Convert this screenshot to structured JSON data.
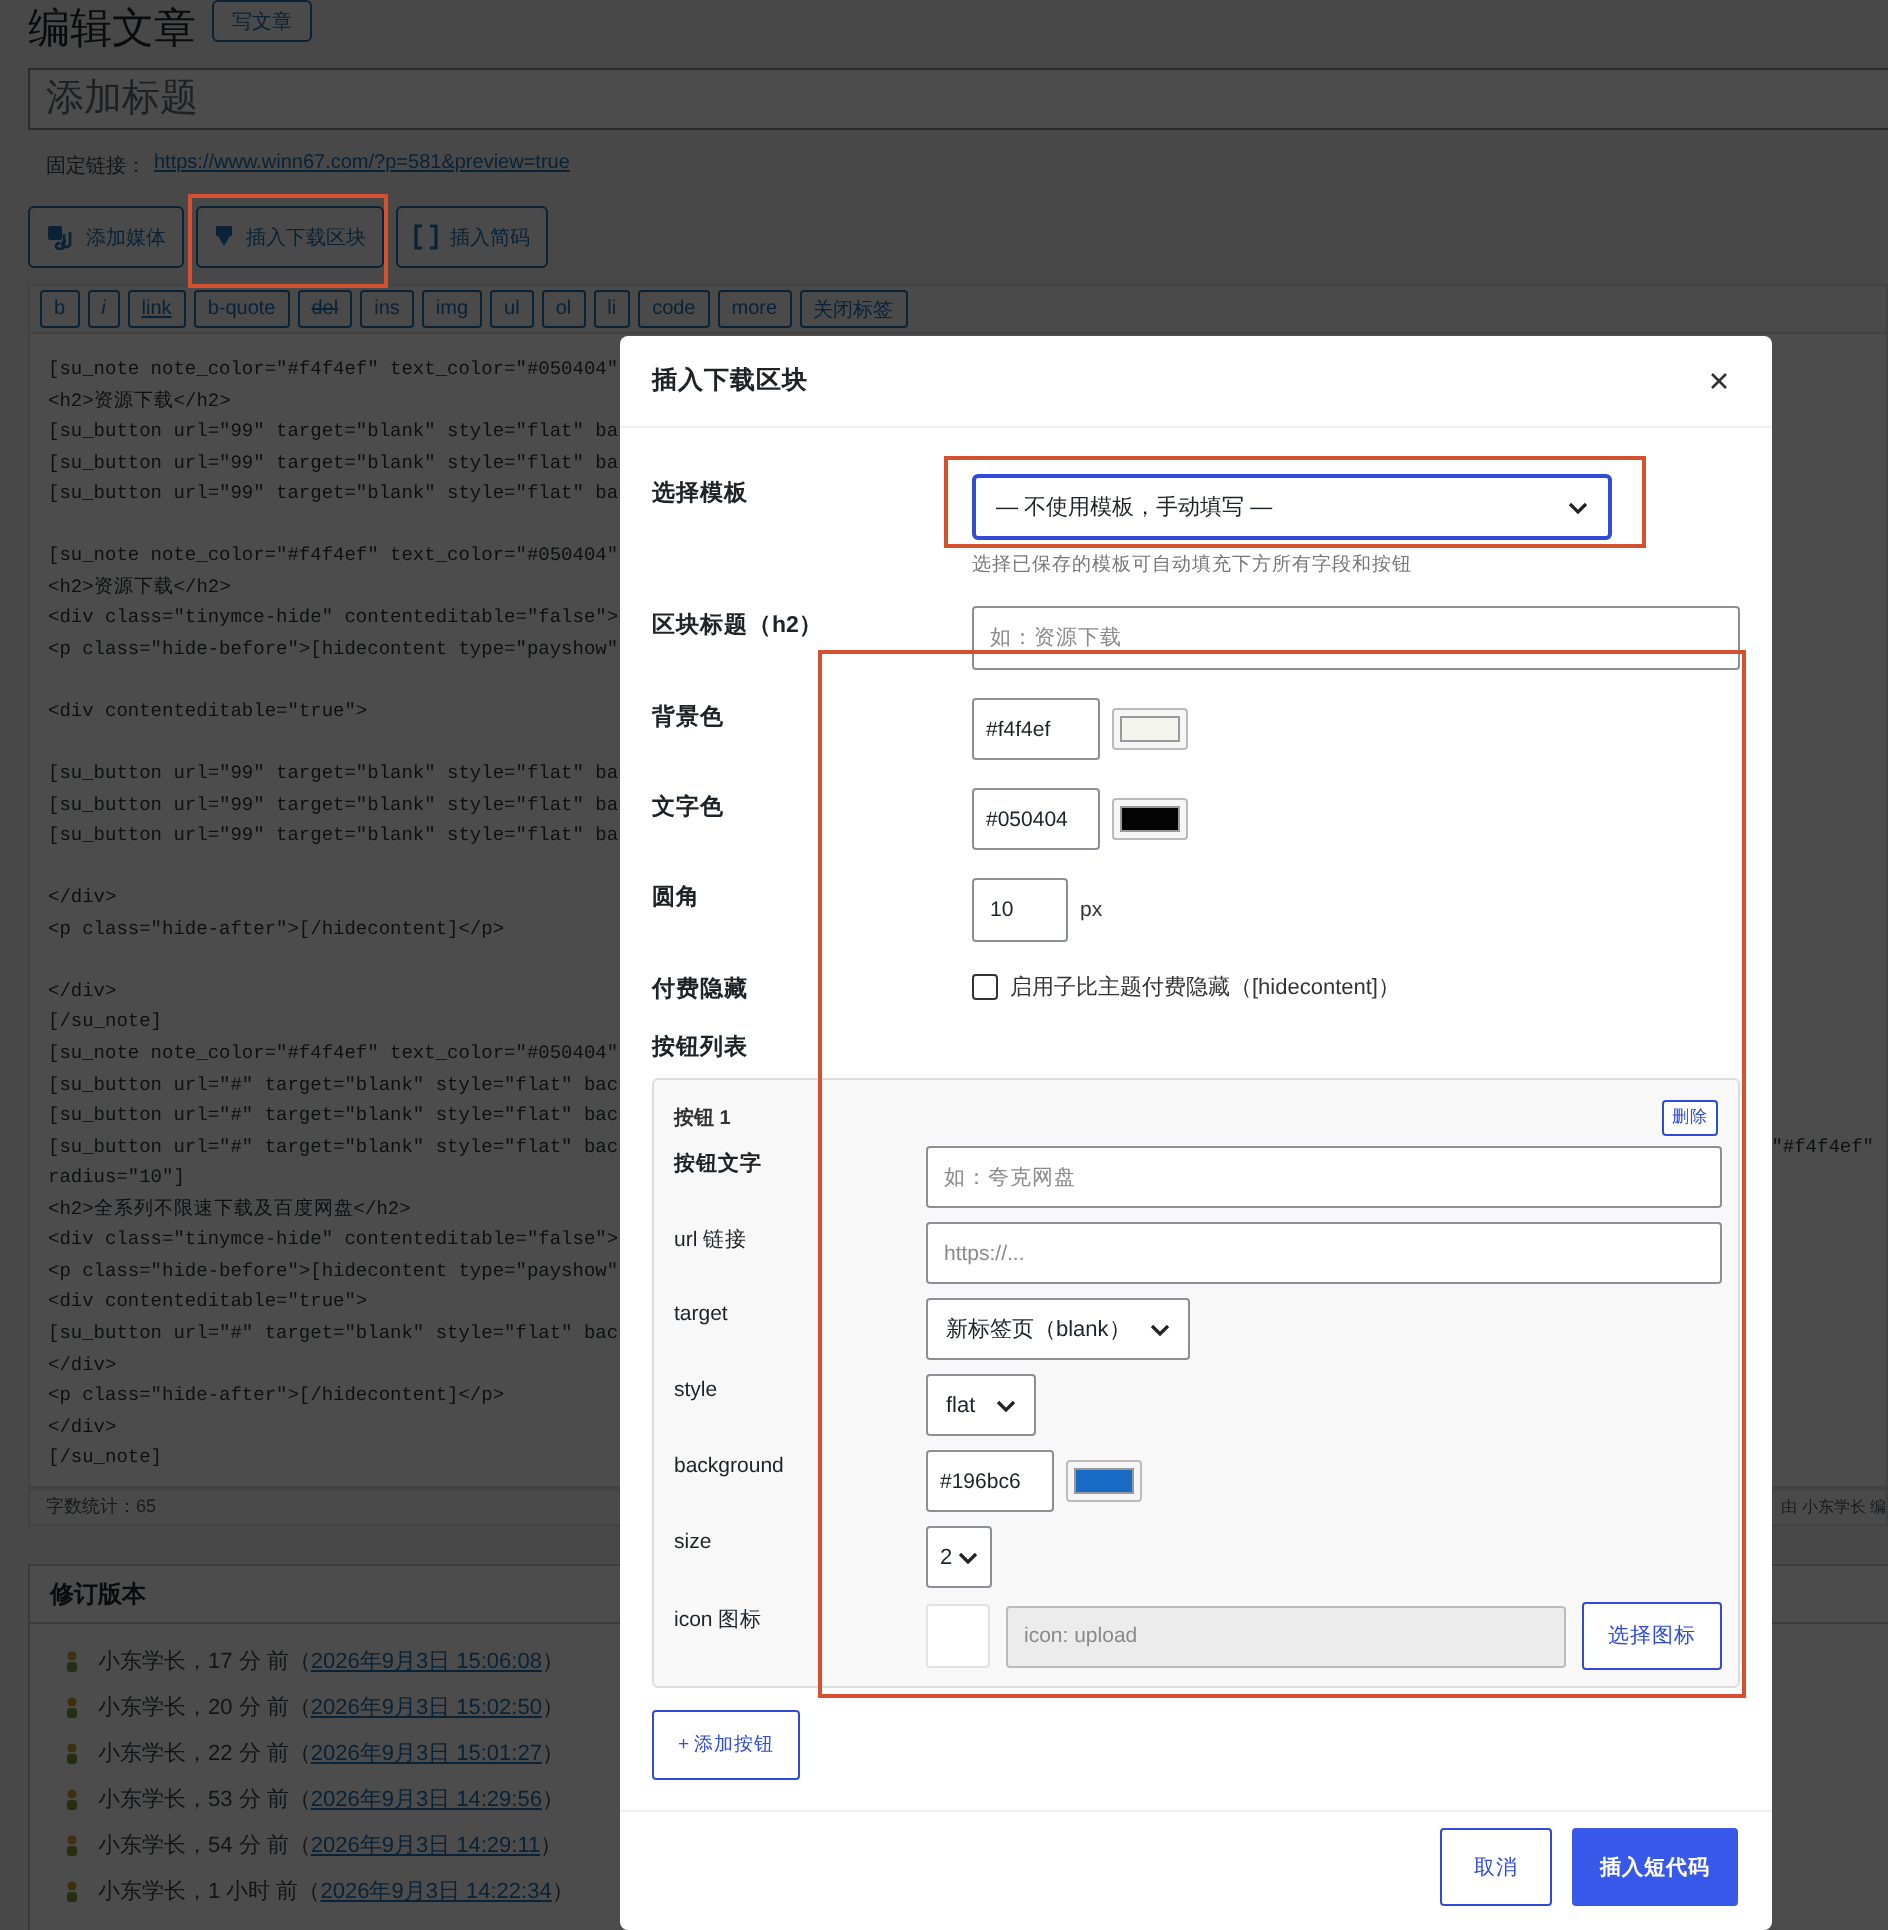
{
  "page": {
    "title": "编辑文章",
    "new_button": "写文章",
    "post_title_placeholder": "添加标题",
    "permalink_label": "固定链接：",
    "permalink": "https://www.winn67.com/?p=581&preview=true"
  },
  "media_buttons": [
    {
      "kind": "media",
      "label": "添加媒体"
    },
    {
      "kind": "download",
      "label": "插入下载区块"
    },
    {
      "kind": "shortcode",
      "label": "插入简码"
    }
  ],
  "quicktags": [
    {
      "label": "b",
      "kind": "plain"
    },
    {
      "label": "i",
      "kind": "italic"
    },
    {
      "label": "link",
      "kind": "underline"
    },
    {
      "label": "b-quote",
      "kind": "plain"
    },
    {
      "label": "del",
      "kind": "strike"
    },
    {
      "label": "ins",
      "kind": "plain"
    },
    {
      "label": "img",
      "kind": "plain"
    },
    {
      "label": "ul",
      "kind": "plain"
    },
    {
      "label": "ol",
      "kind": "plain"
    },
    {
      "label": "li",
      "kind": "plain"
    },
    {
      "label": "code",
      "kind": "plain"
    },
    {
      "label": "more",
      "kind": "plain"
    },
    {
      "label": "关闭标签",
      "kind": "plain"
    }
  ],
  "editor_lines": [
    {
      "kind": "code",
      "text": "[su_note note_color=\"#f4f4ef\" text_color=\"#050404\""
    },
    {
      "kind": "code",
      "text": "<h2>资源下载</h2>"
    },
    {
      "kind": "code",
      "text": "[su_button url=\"99\" target=\"blank\" style=\"flat\" ba"
    },
    {
      "kind": "code",
      "text": "[su_button url=\"99\" target=\"blank\" style=\"flat\" ba"
    },
    {
      "kind": "code",
      "text": "[su_button url=\"99\" target=\"blank\" style=\"flat\" ba"
    },
    {
      "kind": "blank"
    },
    {
      "kind": "code",
      "text": "[su_note note_color=\"#f4f4ef\" text_color=\"#050404\""
    },
    {
      "kind": "code",
      "text": "<h2>资源下载</h2>"
    },
    {
      "kind": "code",
      "text": "<div class=\"tinymce-hide\" contenteditable=\"false\">"
    },
    {
      "kind": "code",
      "text": "<p class=\"hide-before\">[hidecontent type=\"payshow\""
    },
    {
      "kind": "blank"
    },
    {
      "kind": "code",
      "text": "<div contenteditable=\"true\">"
    },
    {
      "kind": "blank"
    },
    {
      "kind": "code",
      "text": "[su_button url=\"99\" target=\"blank\" style=\"flat\" ba"
    },
    {
      "kind": "code",
      "text": "[su_button url=\"99\" target=\"blank\" style=\"flat\" ba"
    },
    {
      "kind": "code",
      "text": "[su_button url=\"99\" target=\"blank\" style=\"flat\" ba"
    },
    {
      "kind": "blank"
    },
    {
      "kind": "code",
      "text": "</div>"
    },
    {
      "kind": "code",
      "text": "<p class=\"hide-after\">[/hidecontent]</p>"
    },
    {
      "kind": "blank"
    },
    {
      "kind": "code",
      "text": "</div>"
    },
    {
      "kind": "code",
      "text": "[/su_note]"
    },
    {
      "kind": "code",
      "text": "[su_note note_color=\"#f4f4ef\" text_color=\"#050404\""
    },
    {
      "kind": "code",
      "text": "[su_button url=\"#\" target=\"blank\" style=\"flat\" bac"
    },
    {
      "kind": "code",
      "text": "[su_button url=\"#\" target=\"blank\" style=\"flat\" bac"
    },
    {
      "kind": "code",
      "text": "[su_button url=\"#\" target=\"blank\" style=\"flat\" bac",
      "right": "\"#f4f4ef\""
    },
    {
      "kind": "code",
      "text": "radius=\"10\"]"
    },
    {
      "kind": "code",
      "text": "<h2>全系列不限速下载及百度网盘</h2>"
    },
    {
      "kind": "code",
      "text": "<div class=\"tinymce-hide\" contenteditable=\"false\">"
    },
    {
      "kind": "code",
      "text": "<p class=\"hide-before\">[hidecontent type=\"payshow\""
    },
    {
      "kind": "code",
      "text": "<div contenteditable=\"true\">"
    },
    {
      "kind": "code",
      "text": "[su_button url=\"#\" target=\"blank\" style=\"flat\" bac"
    },
    {
      "kind": "code",
      "text": "</div>"
    },
    {
      "kind": "code",
      "text": "<p class=\"hide-after\">[/hidecontent]</p>"
    },
    {
      "kind": "code",
      "text": "</div>"
    },
    {
      "kind": "code",
      "text": "[/su_note]"
    }
  ],
  "status_bar": {
    "word_count": "字数统计：65",
    "right": "由 小东学长 编"
  },
  "revisions": {
    "title": "修订版本",
    "items": [
      {
        "text": "小东学长，17 分 前（",
        "link": "2026年9月3日 15:06:08",
        "tail": "）"
      },
      {
        "text": "小东学长，20 分 前（",
        "link": "2026年9月3日 15:02:50",
        "tail": "）"
      },
      {
        "text": "小东学长，22 分 前（",
        "link": "2026年9月3日 15:01:27",
        "tail": "）"
      },
      {
        "text": "小东学长，53 分 前（",
        "link": "2026年9月3日 14:29:56",
        "tail": "）"
      },
      {
        "text": "小东学长，54 分 前（",
        "link": "2026年9月3日 14:29:11",
        "tail": "）"
      },
      {
        "text": "小东学长，1 小时 前（",
        "link": "2026年9月3日 14:22:34",
        "tail": "）"
      }
    ]
  },
  "dialog": {
    "title": "插入下载区块",
    "template": {
      "label": "选择模板",
      "value": "— 不使用模板，手动填写 —",
      "hint": "选择已保存的模板可自动填充下方所有字段和按钮"
    },
    "block_title": {
      "label": "区块标题（h2）",
      "placeholder": "如：资源下载"
    },
    "bg_color": {
      "label": "背景色",
      "value": "#f4f4ef"
    },
    "text_color": {
      "label": "文字色",
      "value": "#050404"
    },
    "radius": {
      "label": "圆角",
      "value": "10",
      "unit": "px"
    },
    "paid_hide": {
      "label": "付费隐藏",
      "checkbox_label": "启用子比主题付费隐藏（[hidecontent]）",
      "checked": false
    },
    "button_list": {
      "label": "按钮列表",
      "buttons": [
        {
          "title": "按钮 1",
          "delete": "删除",
          "text": {
            "label": "按钮文字",
            "placeholder": "如：夸克网盘"
          },
          "url": {
            "label": "url 链接",
            "placeholder": "https://..."
          },
          "target": {
            "label": "target",
            "value": "新标签页（blank）"
          },
          "style": {
            "label": "style",
            "value": "flat"
          },
          "background": {
            "label": "background",
            "value": "#196bc6"
          },
          "size": {
            "label": "size",
            "value": "2"
          },
          "icon": {
            "label": "icon 图标",
            "placeholder": "icon: upload",
            "choose": "选择图标"
          }
        }
      ],
      "add": "+ 添加按钮"
    },
    "cancel": "取消",
    "submit": "插入短代码"
  }
}
